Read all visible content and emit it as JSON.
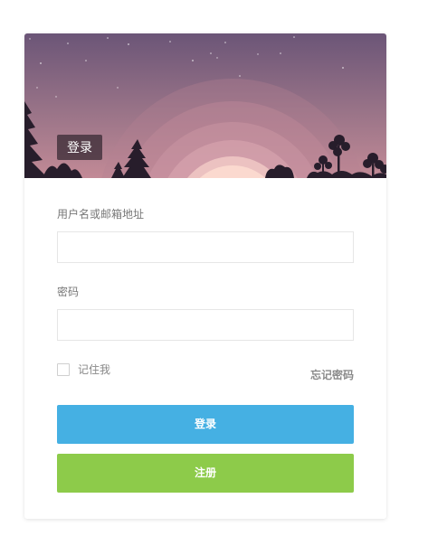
{
  "header": {
    "title": "登录"
  },
  "form": {
    "username_label": "用户名或邮箱地址",
    "username_value": "",
    "password_label": "密码",
    "password_value": "",
    "remember_label": "记住我",
    "remember_checked": false,
    "forgot_label": "忘记密码"
  },
  "buttons": {
    "login_label": "登录",
    "register_label": "注册"
  },
  "colors": {
    "login_button": "#45b0e3",
    "register_button": "#8dcb4a",
    "banner_sky_top": "#6b5577",
    "banner_sky_bottom": "#c28a96",
    "moon": "#fbd9cf",
    "silhouette": "#271d2b"
  },
  "icons": {
    "checkbox": "checkbox-icon"
  }
}
